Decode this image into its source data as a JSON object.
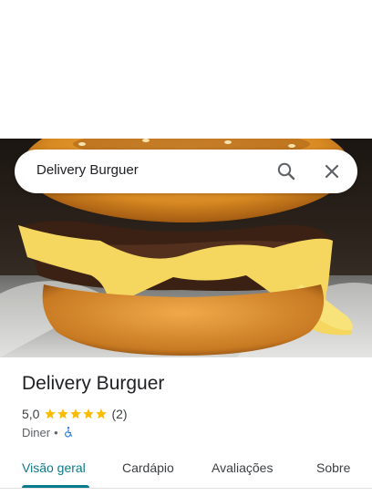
{
  "search": {
    "query": "Delivery Burguer"
  },
  "hero": {
    "image_name": "burger-photo"
  },
  "place": {
    "title": "Delivery Burguer",
    "rating": "5,0",
    "stars": 5,
    "review_count": "(2)",
    "category": "Diner",
    "separator": "•"
  },
  "tabs": [
    {
      "label": "Visão geral",
      "active": true
    },
    {
      "label": "Cardápio",
      "active": false
    },
    {
      "label": "Avaliações",
      "active": false
    },
    {
      "label": "Sobre",
      "active": false
    }
  ],
  "colors": {
    "accent": "#0b7a8a",
    "star": "#fbbc04",
    "accessibility": "#1a73e8"
  }
}
